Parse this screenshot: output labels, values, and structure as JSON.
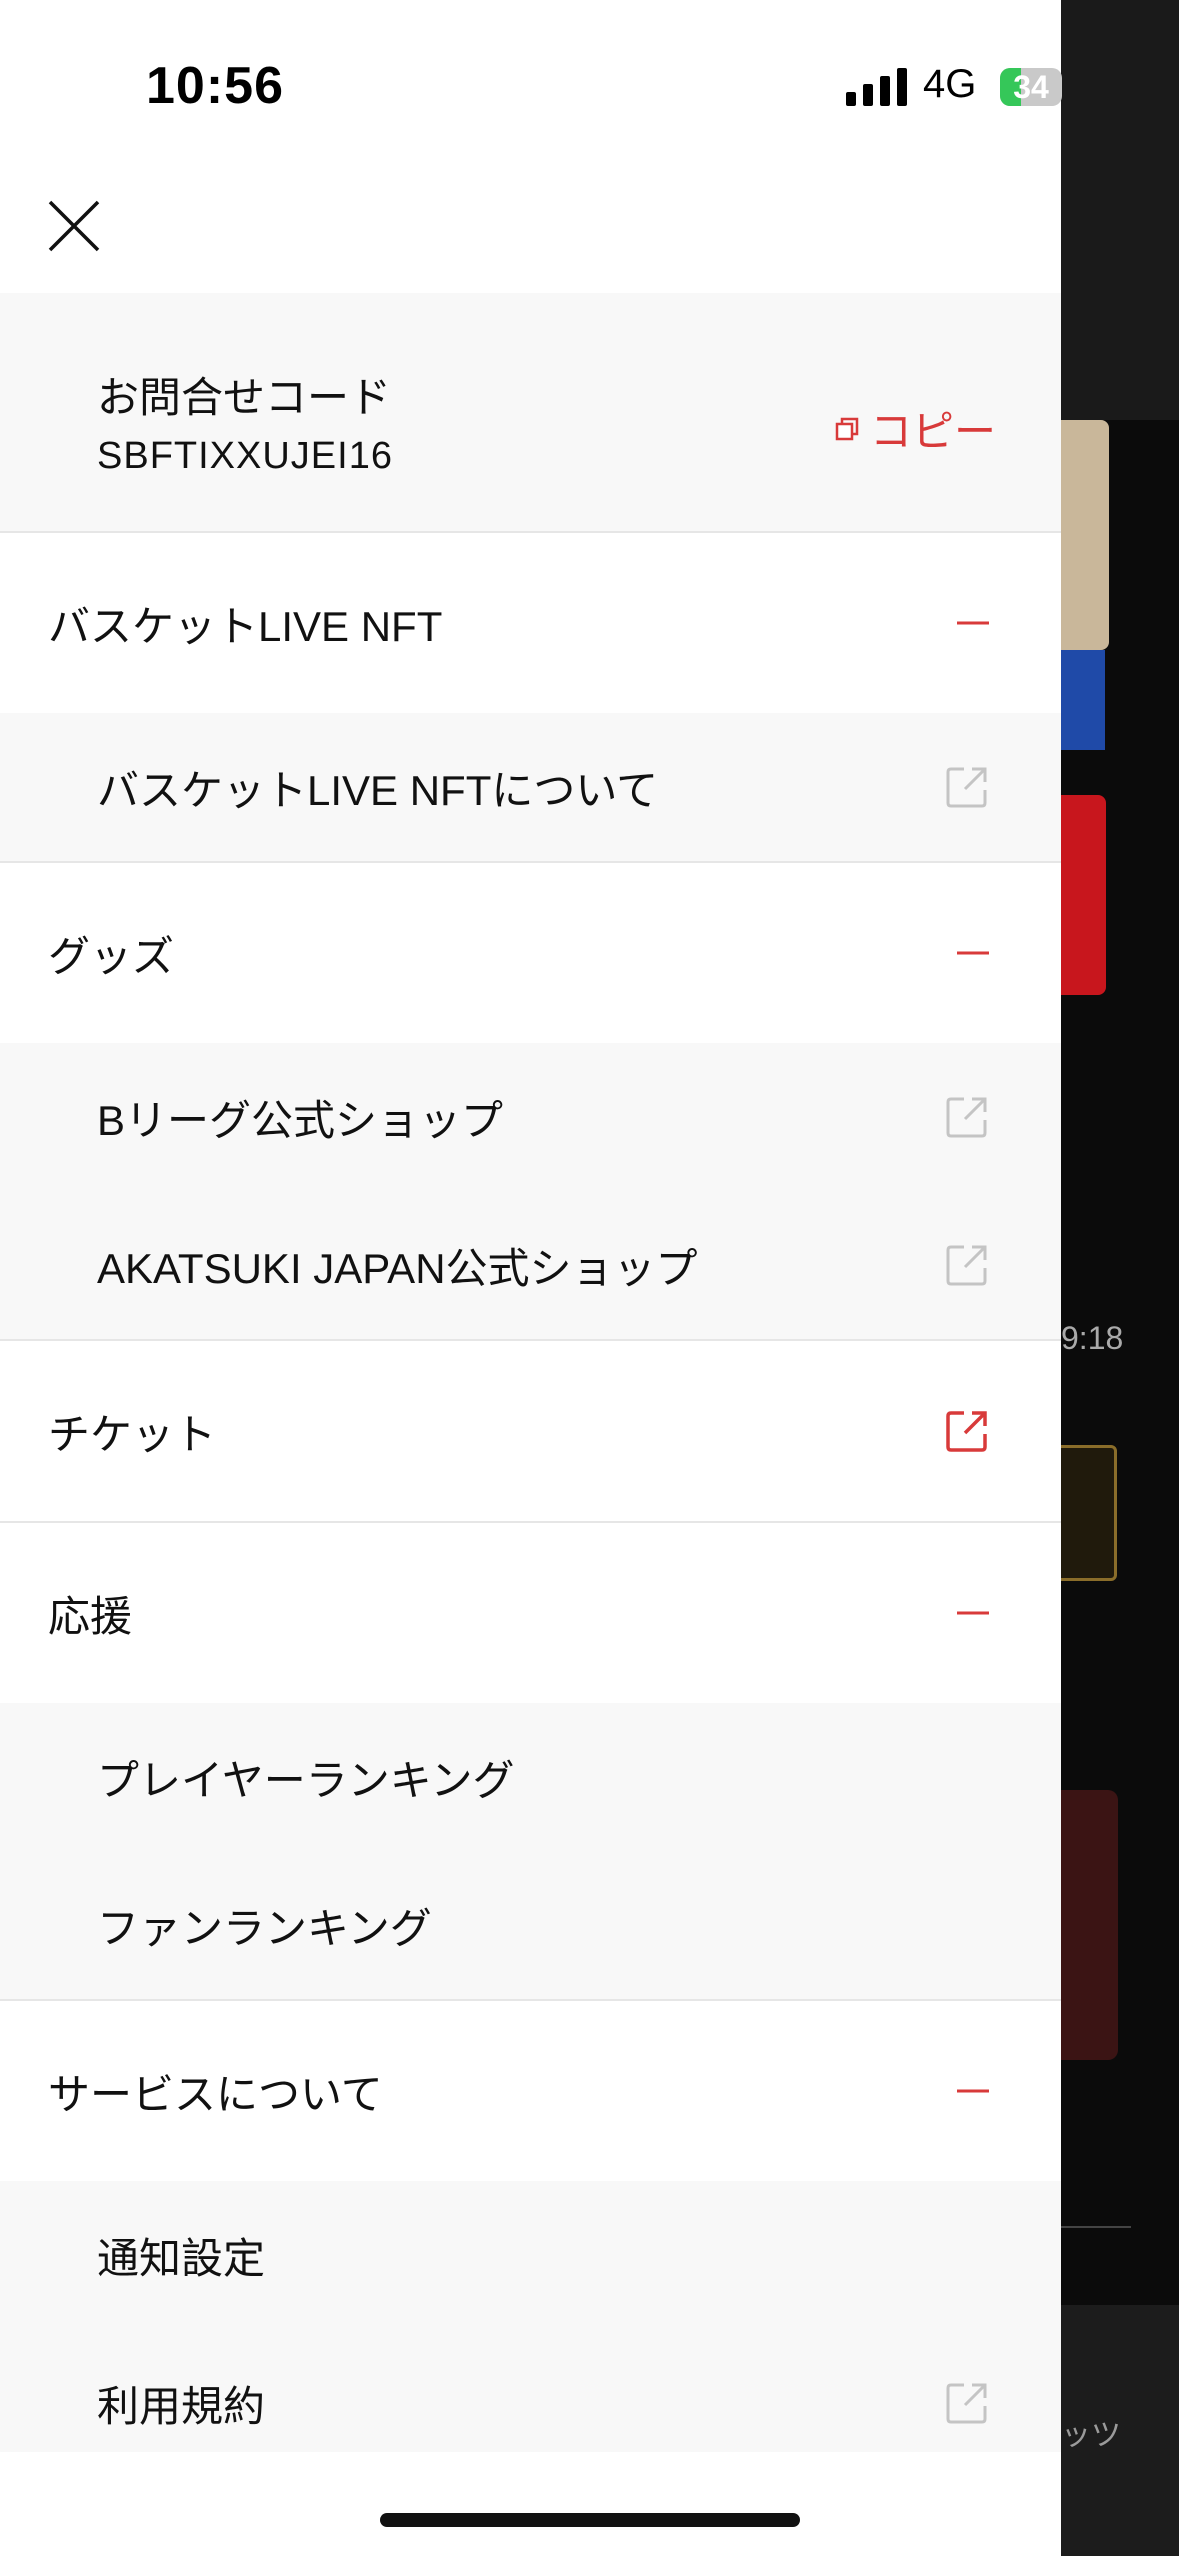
{
  "status": {
    "time": "10:56",
    "network": "4G",
    "battery": "34",
    "battery_level": 0.34
  },
  "colors": {
    "accent": "#d83a3a",
    "section_bg": "#f8f8f8",
    "divider": "#e6e6e6"
  },
  "inquiry": {
    "title": "お問合せコード",
    "code": "SBFTIXXUJEI16",
    "copy_label": "コピー"
  },
  "menu": {
    "basket": {
      "label": "バスケットLIVE NFT",
      "items": [
        {
          "label": "バスケットLIVE NFTについて"
        }
      ]
    },
    "goods": {
      "label": "グッズ",
      "items": [
        {
          "label": "Bリーグ公式ショップ"
        },
        {
          "label": "AKATSUKI JAPAN公式ショップ"
        }
      ]
    },
    "ticket": {
      "label": "チケット"
    },
    "support": {
      "label": "応援",
      "items": [
        {
          "label": "プレイヤーランキング"
        },
        {
          "label": "ファンランキング"
        }
      ]
    },
    "service": {
      "label": "サービスについて",
      "items": [
        {
          "label": "通知設定"
        },
        {
          "label": "利用規約"
        }
      ]
    }
  },
  "background_app": {
    "timestamp": "9:18",
    "tab_label": "ッツ"
  }
}
